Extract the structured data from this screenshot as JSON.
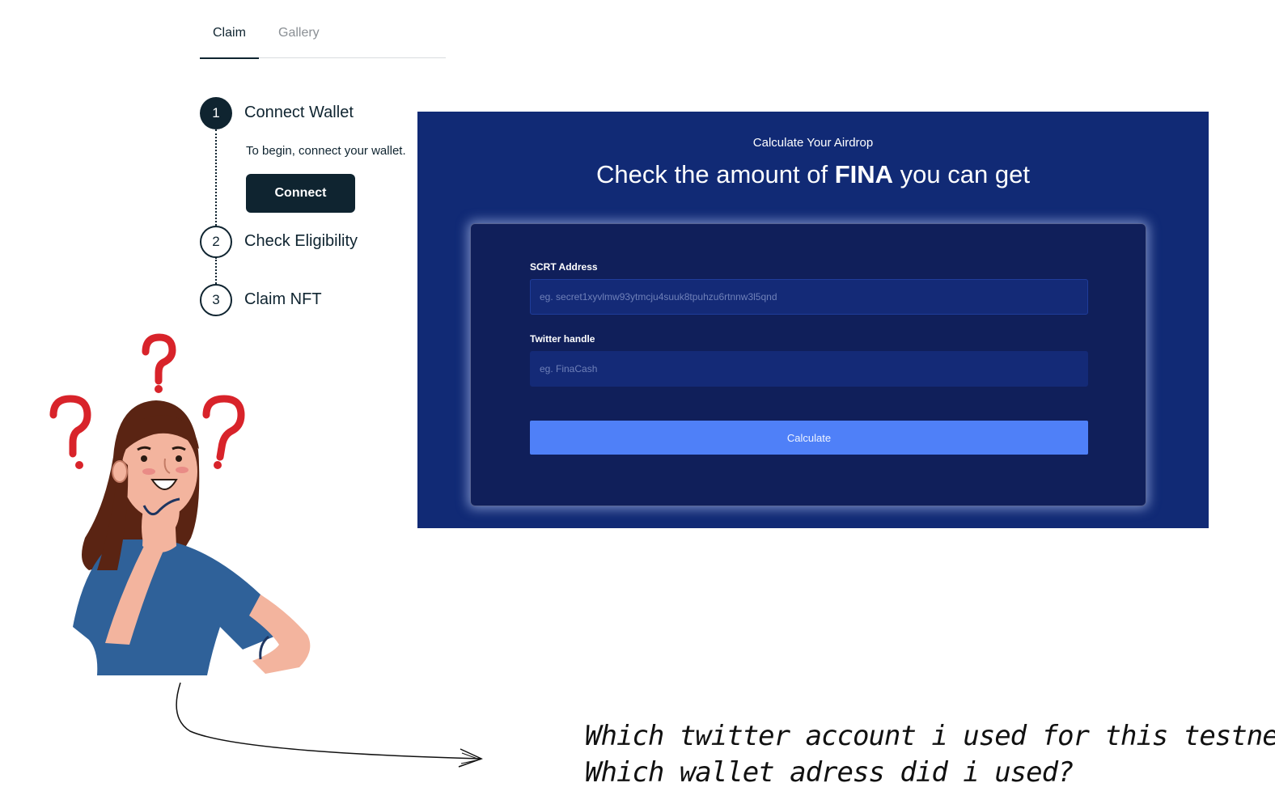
{
  "tabs": [
    {
      "label": "Claim",
      "active": true
    },
    {
      "label": "Gallery",
      "active": false
    }
  ],
  "stepper": {
    "steps": [
      {
        "number": "1",
        "label": "Connect Wallet",
        "state": "active"
      },
      {
        "number": "2",
        "label": "Check Eligibility",
        "state": "pending"
      },
      {
        "number": "3",
        "label": "Claim NFT",
        "state": "pending"
      }
    ],
    "connect_description": "To begin, connect your wallet.",
    "connect_button": "Connect"
  },
  "airdrop": {
    "eyebrow": "Calculate Your Airdrop",
    "headline_prefix": "Check the amount of",
    "headline_token": "FINA",
    "headline_suffix": "you can get",
    "address_label": "SCRT Address",
    "address_placeholder": "eg. secret1xyvlmw93ytmcju4suuk8tpuhzu6rtnnw3l5qnd",
    "address_value": "",
    "twitter_label": "Twitter handle",
    "twitter_placeholder": "eg. FinaCash",
    "twitter_value": "",
    "calculate_button": "Calculate"
  },
  "annotation": {
    "line1": "Which twitter account i used for this testnet?",
    "line2": "Which wallet adress did i used?"
  },
  "colors": {
    "dark": "#0f2430",
    "panel_bg": "#112a75",
    "card_bg": "#101f5a",
    "button_blue": "#4f80f8",
    "question_mark": "#d8232a",
    "shirt": "#2f6199",
    "hair": "#5a2413",
    "skin": "#f3b49e"
  },
  "icons": [
    "question-mark-icon",
    "arrow-icon"
  ]
}
